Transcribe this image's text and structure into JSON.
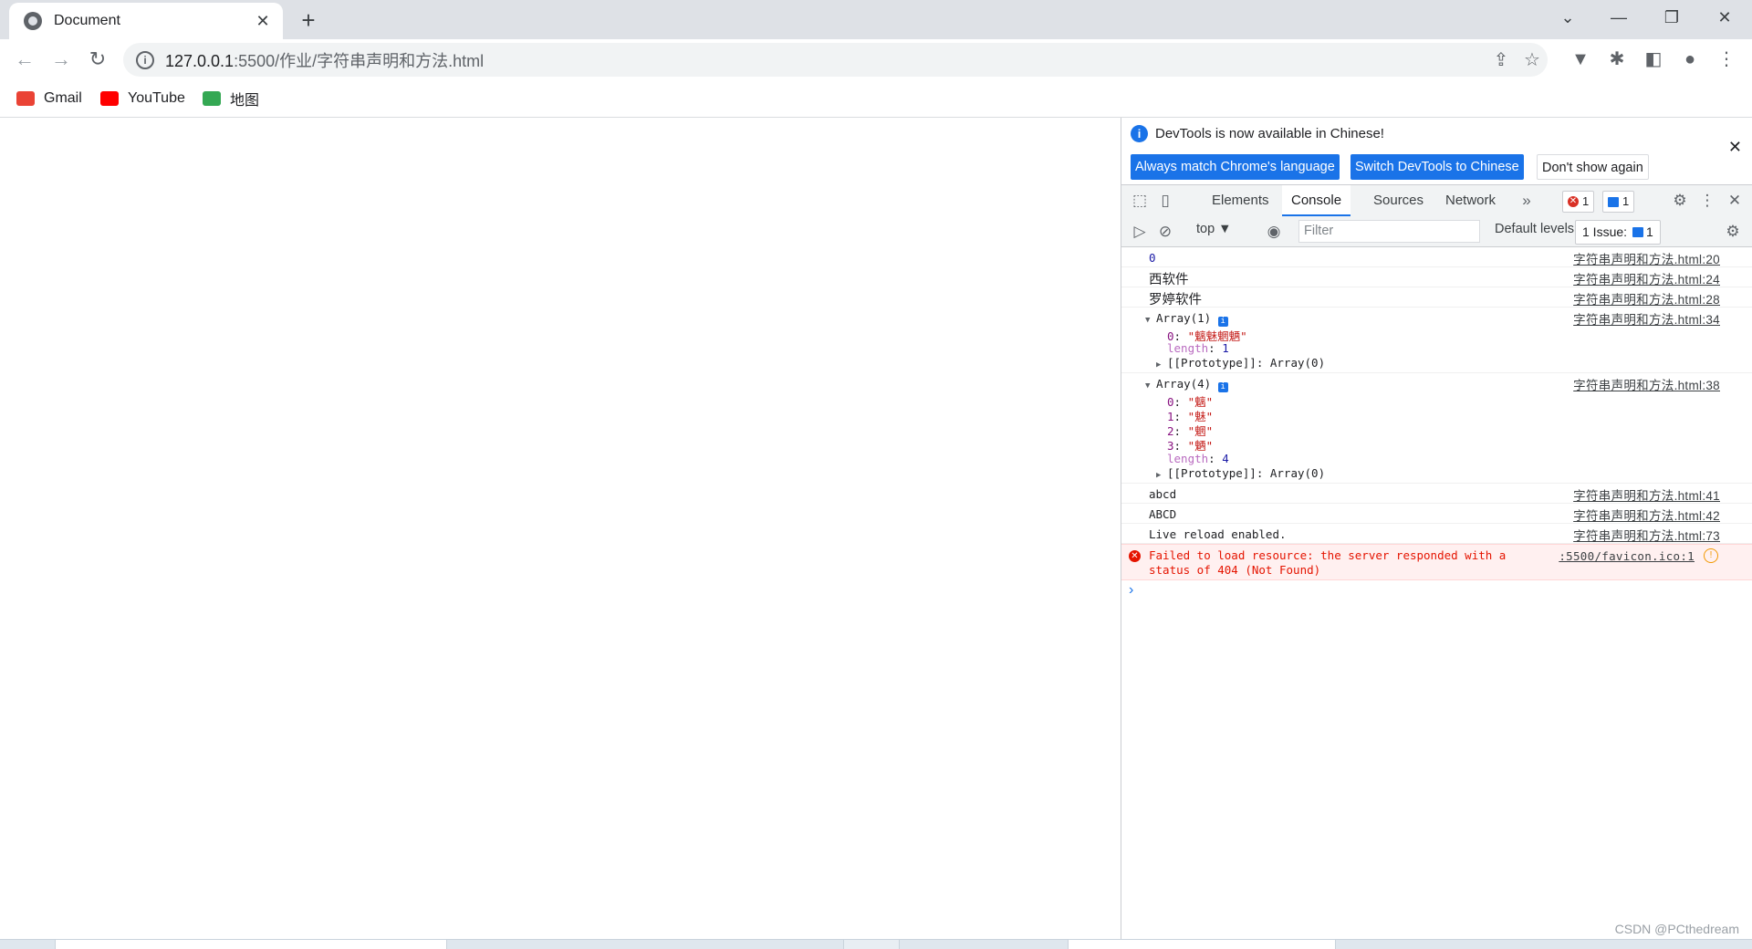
{
  "tab": {
    "title": "Document",
    "close": "✕",
    "new_tab": "+"
  },
  "window": {
    "tabsearch": "⌄",
    "minimize": "—",
    "restore": "❐",
    "close": "✕"
  },
  "toolbar": {
    "back": "←",
    "forward": "→",
    "reload": "↻",
    "url_host": "127.0.0.1",
    "url_rest": ":5500/作业/字符串声明和方法.html",
    "share": "⇪",
    "star": "☆",
    "ext1": "▼",
    "puzzle": "✱",
    "sidepanel": "◧",
    "profile": "●",
    "menu": "⋮"
  },
  "bookmarks": [
    {
      "label": "Gmail",
      "color": "#ea4335"
    },
    {
      "label": "YouTube",
      "color": "#ff0000"
    },
    {
      "label": "地图",
      "color": "#34a853"
    }
  ],
  "devtools": {
    "infobar": {
      "message": "DevTools is now available in Chinese!",
      "btn_match": "Always match Chrome's language",
      "btn_switch": "Switch DevTools to Chinese",
      "btn_dont": "Don't show again",
      "close": "✕"
    },
    "tabs": [
      "Elements",
      "Console",
      "Sources",
      "Network"
    ],
    "more": "»",
    "error_count": "1",
    "message_count": "1",
    "settings": "⚙",
    "kebab": "⋮",
    "close": "✕",
    "console_toolbar": {
      "context": "top ▼",
      "filter_placeholder": "Filter",
      "levels": "Default levels ▼",
      "issues_label": "1 Issue:",
      "issues_count": "1",
      "settings": "⚙"
    },
    "logs": {
      "l1": {
        "value": "0",
        "src": "字符串声明和方法.html:20"
      },
      "l2": {
        "value": "西软件",
        "src": "字符串声明和方法.html:24"
      },
      "l3": {
        "value": "罗婷软件",
        "src": "字符串声明和方法.html:28"
      },
      "l4": {
        "head": "Array(1)",
        "src": "字符串声明和方法.html:34",
        "k0": "0",
        "v0": "\"魑魅魍魉\"",
        "length_key": "length",
        "length_val": "1",
        "proto": "[[Prototype]]: Array(0)"
      },
      "l5": {
        "head": "Array(4)",
        "src": "字符串声明和方法.html:38",
        "k0": "0",
        "v0": "\"魑\"",
        "k1": "1",
        "v1": "\"魅\"",
        "k2": "2",
        "v2": "\"魍\"",
        "k3": "3",
        "v3": "\"魉\"",
        "length_key": "length",
        "length_val": "4",
        "proto": "[[Prototype]]: Array(0)"
      },
      "l6": {
        "value": "abcd",
        "src": "字符串声明和方法.html:41"
      },
      "l7": {
        "value": "ABCD",
        "src": "字符串声明和方法.html:42"
      },
      "l8": {
        "value": "Live reload enabled.",
        "src": "字符串声明和方法.html:73"
      },
      "err": {
        "line1": "Failed to load resource: the server responded with a",
        "line2": "status of 404 (Not Found)",
        "src": ":5500/favicon.ico:1"
      }
    }
  },
  "watermark": "CSDN @PCthedream"
}
